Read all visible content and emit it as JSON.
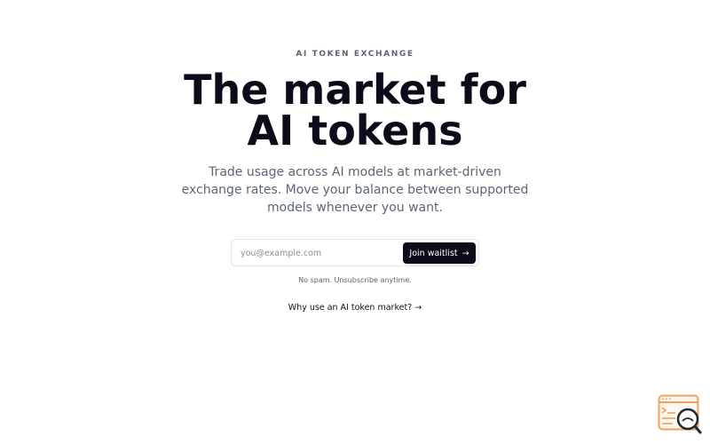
{
  "hero": {
    "eyebrow": "AI TOKEN EXCHANGE",
    "headline_line1": "The market for",
    "headline_line2": "AI tokens",
    "subtitle": "Trade usage across AI models at market-driven exchange rates. Move your balance between supported models whenever you want."
  },
  "waitlist": {
    "email_placeholder": "you@example.com",
    "email_value": "",
    "join_label": "Join waitlist",
    "join_arrow": "→",
    "note": "No spam. Unsubscribe anytime."
  },
  "links": {
    "why_label": "Why use an AI token market? →"
  },
  "colors": {
    "primary": "#0b0b1a",
    "muted": "#5d6675",
    "widget_accent": "#f0a060",
    "widget_dark": "#1f2a33"
  },
  "icons": {
    "corner_widget": "browser-search-icon"
  }
}
